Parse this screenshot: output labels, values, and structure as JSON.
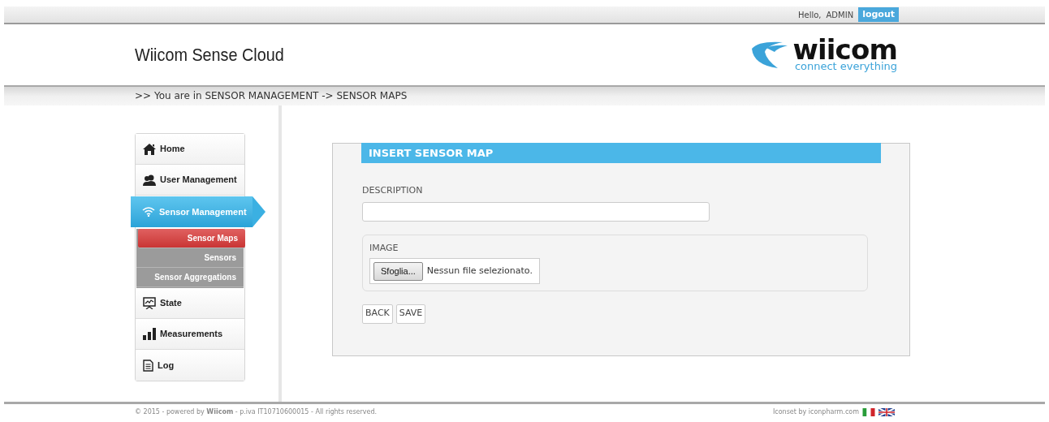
{
  "top_bar": {
    "greeting": "Hello,",
    "user": "ADMIN",
    "logout": "logout"
  },
  "header": {
    "title": "Wiicom Sense Cloud",
    "logo": {
      "name": "wiicom",
      "tagline": "connect everything"
    }
  },
  "breadcrumb": ">> You are in SENSOR MANAGEMENT -> SENSOR MAPS",
  "sidebar": {
    "items": [
      {
        "label": "Home",
        "selected": false
      },
      {
        "label": "User Management",
        "selected": false
      },
      {
        "label": "Sensor Management",
        "selected": true,
        "children": [
          {
            "label": "Sensor Maps",
            "selected": true
          },
          {
            "label": "Sensors",
            "selected": false
          },
          {
            "label": "Sensor Aggregations",
            "selected": false
          }
        ]
      },
      {
        "label": "State",
        "selected": false
      },
      {
        "label": "Measurements",
        "selected": false
      },
      {
        "label": "Log",
        "selected": false
      }
    ]
  },
  "form": {
    "title": "INSERT SENSOR MAP",
    "description_label": "DESCRIPTION",
    "image_label": "IMAGE",
    "file_button": "Sfoglia...",
    "file_status": "Nessun file selezionato.",
    "buttons": [
      "BACK",
      "SAVE"
    ]
  },
  "footer": {
    "copyright": "© 2015 - powered by **Wiicom** - p.iva IT10710600015 - All rights reserved.",
    "iconset": "Iconset by iconpharm.com"
  }
}
